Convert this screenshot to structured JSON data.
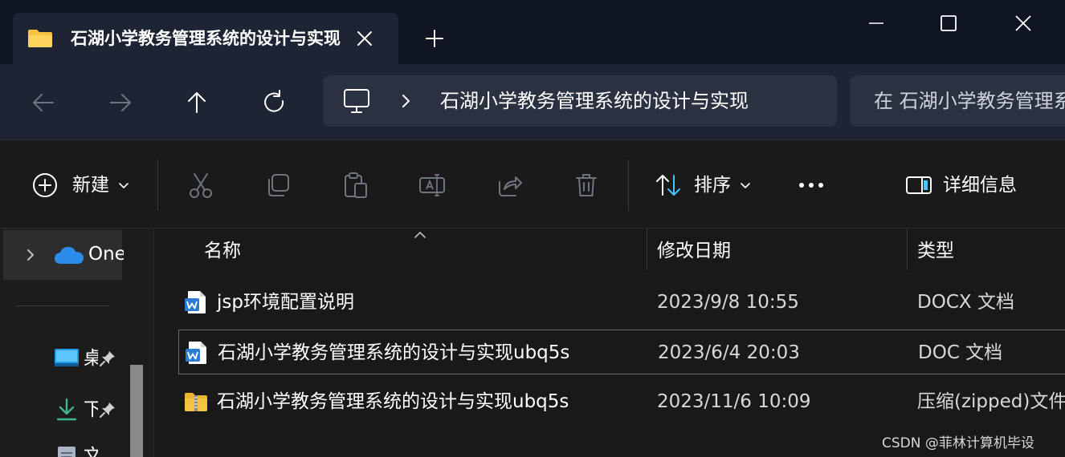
{
  "tab": {
    "title": "石湖小学教务管理系统的设计与实现",
    "icon": "folder-icon",
    "close_icon": "close-icon",
    "new_tab_icon": "plus-icon"
  },
  "window_controls": [
    "minimize-icon",
    "maximize-icon",
    "close-icon"
  ],
  "navigation": {
    "buttons": [
      "back-arrow-icon",
      "forward-arrow-icon",
      "up-arrow-icon",
      "refresh-icon"
    ],
    "address": {
      "icon": "computer-icon",
      "separator_icon": "chevron-right-icon",
      "path_text": "石湖小学教务管理系统的设计与实现"
    },
    "search": {
      "text": "在 石湖小学教务管理系统的设计与实现 中搜索"
    }
  },
  "commandbar": {
    "new_label": "新建",
    "sort_label": "排序",
    "details_label": "详细信息",
    "icons": [
      "add-circle-icon",
      "cut-icon",
      "copy-icon",
      "paste-icon",
      "rename-icon",
      "share-icon",
      "delete-icon",
      "sort-icon",
      "more-icon",
      "details-pane-icon"
    ]
  },
  "sidebar": {
    "onedrive_label": "OneDrive",
    "items": [
      {
        "label": "桌面",
        "icon": "desktop-icon",
        "pinned": true
      },
      {
        "label": "下载",
        "icon": "download-icon",
        "pinned": true
      },
      {
        "label": "文档",
        "icon": "documents-icon",
        "pinned": true
      }
    ]
  },
  "columns": {
    "name": "名称",
    "modified": "修改日期",
    "type": "类型"
  },
  "files": [
    {
      "name": "jsp环境配置说明",
      "modified": "2023/9/8 10:55",
      "type": "DOCX 文档",
      "icon": "word-document-icon",
      "selected": false
    },
    {
      "name": "石湖小学教务管理系统的设计与实现ubq5s",
      "modified": "2023/6/4 20:03",
      "type": "DOC 文档",
      "icon": "word-document-icon",
      "selected": true
    },
    {
      "name": "石湖小学教务管理系统的设计与实现ubq5s",
      "modified": "2023/11/6 10:09",
      "type": "压缩(zipped)文件夹",
      "icon": "zip-folder-icon",
      "selected": false
    }
  ],
  "watermark": "CSDN @菲林计算机毕设",
  "colors": {
    "accent_blue": "#4cc2ff",
    "folder_yellow": "#f5c242",
    "word_blue": "#2b7cd3",
    "selection_border": "#6b6b6b"
  }
}
